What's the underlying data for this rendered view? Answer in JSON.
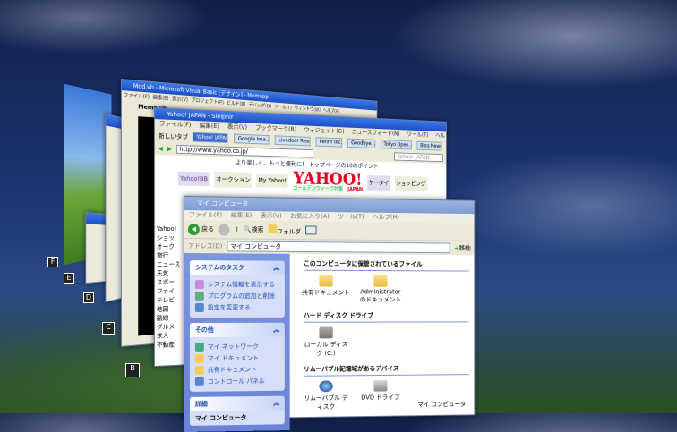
{
  "desktop_icons": [
    "F",
    "E",
    "D",
    "C",
    "B"
  ],
  "vb_window": {
    "title": "Mod.vb - Microsoft Visual Basic [デザイン] - Memopp",
    "menu": [
      "ファイル(F)",
      "編集(E)",
      "表示(V)",
      "プロジェクト(P)",
      "ビルド(B)",
      "デバッグ(D)",
      "ツール(T)",
      "ウィンドウ(W)",
      "ヘルプ(H)"
    ],
    "tab": "Memo.vb"
  },
  "browser": {
    "title": "Yahoo! JAPAN - Sleipnir",
    "menu": [
      "ファイル(F)",
      "編集(E)",
      "表示(V)",
      "ブックマーク(B)",
      "ウィジェット(G)",
      "ニュースフィード(N)",
      "ツール(T)",
      "ヘルプ(H)"
    ],
    "new_tab": "新しいタブ",
    "tabs": [
      "Yahoo! JAPAN",
      "Google Ima...",
      "Livedoor Rea...",
      "Fenrir Inc.",
      "Goodbye...",
      "Tokyo Open...",
      "Blog News"
    ],
    "url": "http://www.yahoo.co.jp/",
    "search_placeholder": "Yahoo! JAPAN",
    "banner": "より楽しく、もっと便利に！ トップページの10のポイント",
    "logo": "YAHOO!",
    "logo_sub": "JAPAN",
    "golden": "ゴールデンウィーク特集",
    "services": [
      "Yahoo!BB",
      "オークション",
      "My Yahoo!",
      "ケータイ",
      "ショッピング"
    ],
    "side_items": [
      "Yahoo!",
      "ショッ",
      "オーク",
      "旅行",
      "ニュース",
      "天気",
      "スポー",
      "ファイ",
      "テレビ",
      "地図",
      "路線",
      "グルメ",
      "求人",
      "不動産"
    ]
  },
  "explorer": {
    "title": "マイ コンピュータ",
    "menu": [
      "ファイル(F)",
      "編集(E)",
      "表示(V)",
      "お気に入り(A)",
      "ツール(T)",
      "ヘルプ(H)"
    ],
    "back": "戻る",
    "search": "検索",
    "folders": "フォルダ",
    "address_label": "アドレス(D)",
    "address": "マイ コンピュータ",
    "go": "移動",
    "system_tasks": {
      "title": "システムのタスク",
      "items": [
        "システム情報を表示する",
        "プログラムの追加と削除",
        "設定を変更する"
      ]
    },
    "other_places": {
      "title": "その他",
      "items": [
        "マイ ネットワーク",
        "マイ ドキュメント",
        "共有ドキュメント",
        "コントロール パネル"
      ]
    },
    "details": {
      "title": "詳細",
      "name": "マイ コンピュータ"
    },
    "sections": [
      {
        "title": "このコンピュータに保管されているファイル",
        "items": [
          "共有ドキュメント",
          "Administrator のドキュメント"
        ]
      },
      {
        "title": "ハード ディスク ドライブ",
        "items": [
          "ローカル ディスク (C:)"
        ]
      },
      {
        "title": "リムーバブル記憶域があるデバイス",
        "items": [
          "リムーバブル ディスク",
          "DVD ドライブ"
        ]
      }
    ],
    "status": "マイ コンピュータ"
  }
}
